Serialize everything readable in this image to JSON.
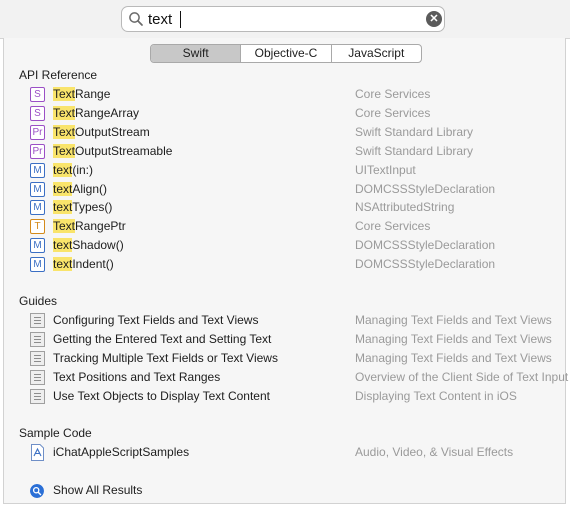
{
  "search": {
    "query": "text",
    "placeholder": ""
  },
  "segmented": {
    "tabs": [
      "Swift",
      "Objective-C",
      "JavaScript"
    ],
    "selected": "Swift"
  },
  "api_reference": {
    "title": "API Reference",
    "items": [
      {
        "badge": "S",
        "badge_color": "#9b4fc6",
        "match": "Text",
        "rest": "Range",
        "source": "Core Services"
      },
      {
        "badge": "S",
        "badge_color": "#9b4fc6",
        "match": "Text",
        "rest": "RangeArray",
        "source": "Core Services"
      },
      {
        "badge": "Pr",
        "badge_color": "#9b4fc6",
        "match": "Text",
        "rest": "OutputStream",
        "source": "Swift Standard Library"
      },
      {
        "badge": "Pr",
        "badge_color": "#9b4fc6",
        "match": "Text",
        "rest": "OutputStreamable",
        "source": "Swift Standard Library"
      },
      {
        "badge": "M",
        "badge_color": "#3b6fc4",
        "match": "text",
        "rest": "(in:)",
        "source": "UITextInput"
      },
      {
        "badge": "M",
        "badge_color": "#3b6fc4",
        "match": "text",
        "rest": "Align()",
        "source": "DOMCSSStyleDeclaration"
      },
      {
        "badge": "M",
        "badge_color": "#3b6fc4",
        "match": "text",
        "rest": "Types()",
        "source": "NSAttributedString"
      },
      {
        "badge": "T",
        "badge_color": "#d48a1a",
        "match": "Text",
        "rest": "RangePtr",
        "source": "Core Services"
      },
      {
        "badge": "M",
        "badge_color": "#3b6fc4",
        "match": "text",
        "rest": "Shadow()",
        "source": "DOMCSSStyleDeclaration"
      },
      {
        "badge": "M",
        "badge_color": "#3b6fc4",
        "match": "text",
        "rest": "Indent()",
        "source": "DOMCSSStyleDeclaration"
      }
    ]
  },
  "guides": {
    "title": "Guides",
    "items": [
      {
        "title": "Configuring Text Fields and Text Views",
        "source": "Managing Text Fields and Text Views"
      },
      {
        "title": "Getting the Entered Text and Setting Text",
        "source": "Managing Text Fields and Text Views"
      },
      {
        "title": "Tracking Multiple Text Fields or Text Views",
        "source": "Managing Text Fields and Text Views"
      },
      {
        "title": "Text Positions and Text Ranges",
        "source": "Overview of the Client Side of Text Input"
      },
      {
        "title": "Use Text Objects to Display Text Content",
        "source": "Displaying Text Content in iOS"
      }
    ]
  },
  "sample_code": {
    "title": "Sample Code",
    "items": [
      {
        "title": "iChatAppleScriptSamples",
        "source": "Audio, Video, & Visual Effects"
      }
    ]
  },
  "show_all": {
    "label": "Show All Results"
  }
}
